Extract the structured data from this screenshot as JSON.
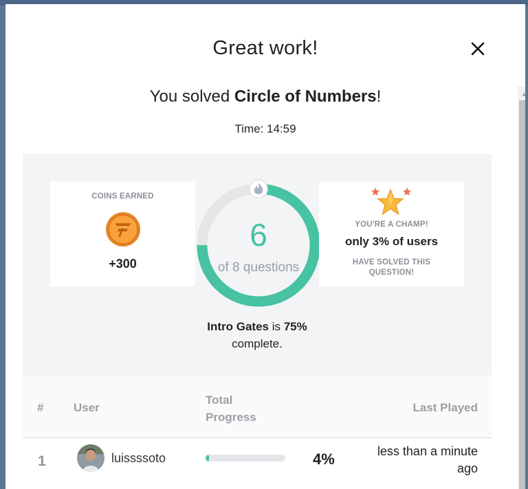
{
  "modal": {
    "title": "Great work!",
    "close_label": "close",
    "solved_prefix": "You solved ",
    "puzzle_name": "Circle of Numbers",
    "solved_suffix": "!",
    "time_label": "Time: 14:59"
  },
  "coins_card": {
    "label": "COINS EARNED",
    "value": "+300",
    "icon": "coin-icon"
  },
  "progress_ring": {
    "solved": "6",
    "caption": "of 8 questions",
    "fraction": 0.75,
    "icon": "flame-icon",
    "colors": {
      "progress": "#47c2a2",
      "track": "#e6e6e6"
    }
  },
  "gates": {
    "name": "Intro Gates",
    "connector": " is ",
    "percent": "75%",
    "suffix": " complete."
  },
  "champ_card": {
    "label": "YOU'RE A CHAMP!",
    "text": "only 3% of users",
    "sub": "HAVE SOLVED THIS QUESTION!",
    "icon": "star-icon"
  },
  "leaderboard": {
    "headers": {
      "rank": "#",
      "user": "User",
      "progress": "Total Progress",
      "last_played": "Last Played"
    },
    "rows": [
      {
        "rank": "1",
        "user": "luissssoto",
        "progress": 0.04,
        "percent": "4%",
        "last_played": "less than a minute ago"
      }
    ]
  }
}
